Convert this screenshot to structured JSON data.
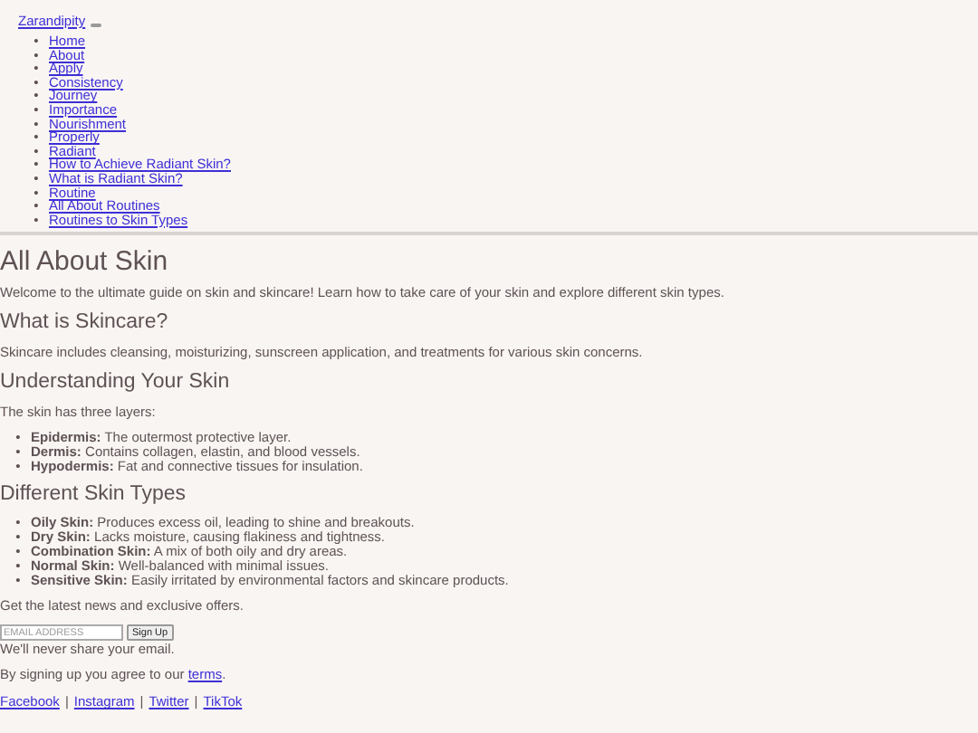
{
  "brand": "Zarandipity",
  "nav": [
    "Home",
    "About",
    "Apply",
    "Consistency",
    "Journey",
    "Importance",
    "Nourishment",
    "Properly",
    "Radiant",
    "How to Achieve Radiant Skin?",
    "What is Radiant Skin?",
    "Routine",
    "All About Routines",
    "Routines to Skin Types"
  ],
  "title": "All About Skin",
  "intro": "Welcome to the ultimate guide on skin and skincare! Learn how to take care of your skin and explore different skin types.",
  "sections": [
    {
      "heading": "What is Skincare?",
      "text": "Skincare includes cleansing, moisturizing, sunscreen application, and treatments for various skin concerns."
    },
    {
      "heading": "Understanding Your Skin",
      "text": "The skin has three layers:",
      "items": [
        "**Epidermis:** The outermost protective layer.",
        "**Dermis:** Contains collagen, elastin, and blood vessels.",
        "**Hypodermis:** Fat and connective tissues for insulation."
      ]
    },
    {
      "heading": "Different Skin Types",
      "items": [
        "**Oily Skin:** Produces excess oil, leading to shine and breakouts.",
        "**Dry Skin:** Lacks moisture, causing flakiness and tightness.",
        "**Combination Skin:** A mix of both oily and dry areas.",
        "**Normal Skin:** Well-balanced with minimal issues.",
        "**Sensitive Skin:** Easily irritated by environmental factors and skincare products."
      ]
    }
  ],
  "newsletter": {
    "text": "Get the latest news and exclusive offers.",
    "placeholder": "EMAIL ADDRESS",
    "button": "Sign Up",
    "note": "We'll never share your email.",
    "terms_text": "By signing up you agree to our",
    "terms_link": "terms",
    "terms_end": "."
  },
  "social": [
    "Facebook",
    "Instagram",
    "Twitter",
    "TikTok"
  ],
  "social_separator": "|",
  "bullet": "•"
}
